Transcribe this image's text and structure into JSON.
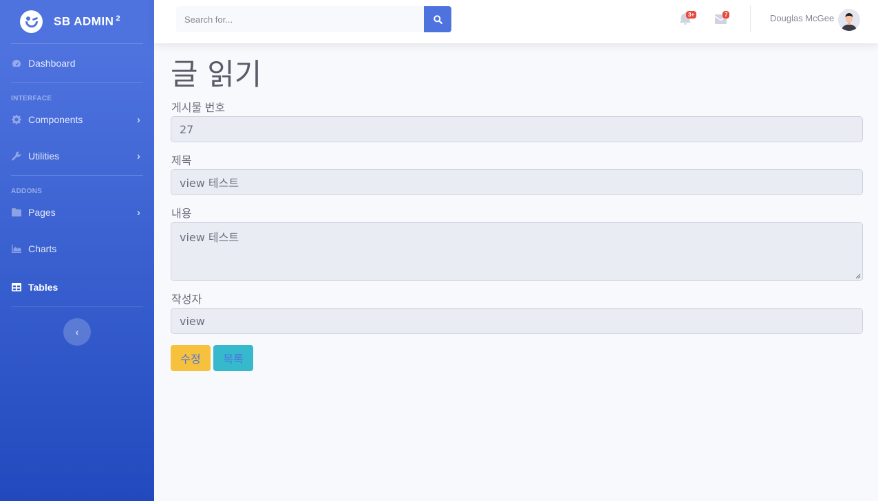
{
  "brand": {
    "name": "SB ADMIN",
    "superscript": "2"
  },
  "sidebar": {
    "dashboard": "Dashboard",
    "heading_interface": "INTERFACE",
    "components": "Components",
    "utilities": "Utilities",
    "heading_addons": "ADDONS",
    "pages": "Pages",
    "charts": "Charts",
    "tables": "Tables"
  },
  "topbar": {
    "search_placeholder": "Search for...",
    "alerts_badge": "3+",
    "messages_badge": "7",
    "user_name": "Douglas McGee"
  },
  "page": {
    "title": "글 읽기",
    "fields": {
      "number_label": "게시물 번호",
      "number_value": "27",
      "title_label": "제목",
      "title_value": "view 테스트",
      "content_label": "내용",
      "content_value": "view 테스트",
      "author_label": "작성자",
      "author_value": "view"
    },
    "buttons": {
      "edit": "수정",
      "list": "목록"
    }
  },
  "colors": {
    "primary": "#4e73df",
    "warning": "#f6c23e",
    "info": "#36b9cc",
    "danger": "#e74a3b"
  }
}
